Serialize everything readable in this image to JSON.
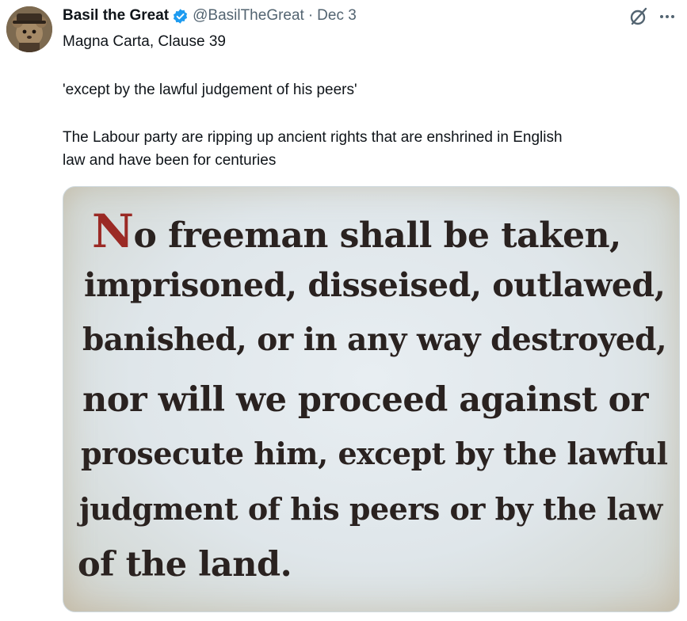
{
  "tweet": {
    "display_name": "Basil the Great",
    "handle": "@BasilTheGreat",
    "separator": "·",
    "date": "Dec 3",
    "lines": [
      "Magna Carta, Clause 39",
      "'except by the lawful judgement of his peers'",
      "The Labour party are ripping up ancient rights that are enshrined in English",
      "law and have been for centuries"
    ]
  },
  "media": {
    "dropcap": "N",
    "first_line_rest": "o freeman shall be taken,",
    "lines": [
      "imprisoned, disseised, outlawed,",
      "banished, or in any way destroyed,",
      "nor will we proceed against or",
      "prosecute him, except by the lawful",
      "judgment of his peers or by the law",
      "of the land."
    ]
  },
  "icons": {
    "verified": "verified-badge-icon",
    "grok": "grok-icon",
    "more": "more-icon"
  },
  "colors": {
    "verified_blue": "#1d9bf0",
    "secondary_text": "#536471",
    "dropcap_red": "#9b2a25"
  }
}
